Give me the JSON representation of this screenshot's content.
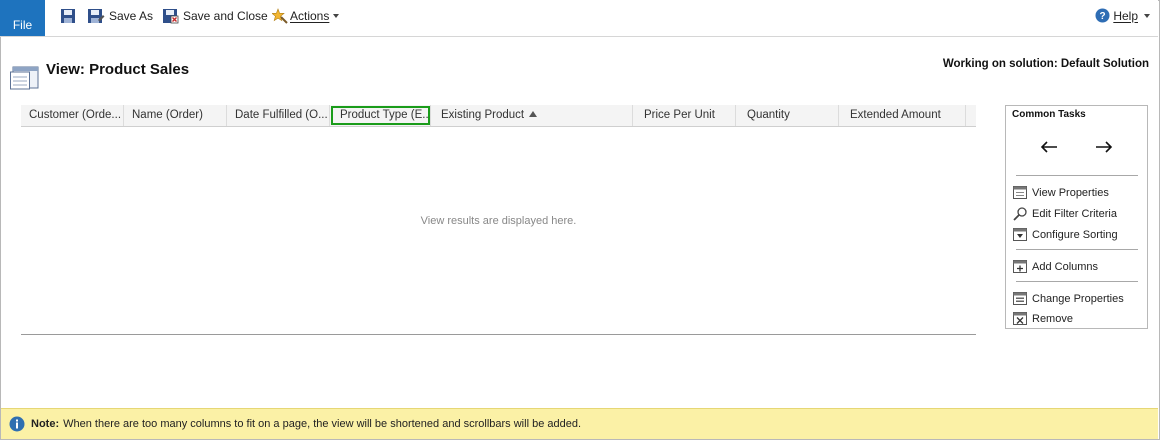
{
  "ribbon": {
    "file_label": "File",
    "save_label": "",
    "save_as_label": "Save As",
    "save_close_label": "Save and Close",
    "actions_label": "Actions",
    "help_label": "Help"
  },
  "header": {
    "title": "View: Product Sales",
    "solution": "Working on solution: Default Solution"
  },
  "grid": {
    "columns": [
      {
        "label": "Customer (Orde..."
      },
      {
        "label": "Name (Order)"
      },
      {
        "label": "Date Fulfilled (O..."
      },
      {
        "label": "Product Type (E..."
      },
      {
        "label": "Existing Product"
      },
      {
        "label": "Price Per Unit"
      },
      {
        "label": "Quantity"
      },
      {
        "label": "Extended Amount"
      }
    ],
    "selected_column": "Product Type (E...",
    "sorted_column": "Existing Product",
    "sort_direction": "ascending",
    "empty_message": "View results are displayed here."
  },
  "tasks": {
    "title": "Common Tasks",
    "items": [
      {
        "label": "View Properties",
        "icon": "view-properties-icon"
      },
      {
        "label": "Edit Filter Criteria",
        "icon": "filter-icon"
      },
      {
        "label": "Configure Sorting",
        "icon": "sort-icon"
      },
      {
        "label": "Add Columns",
        "icon": "add-columns-icon"
      },
      {
        "label": "Change Properties",
        "icon": "change-properties-icon"
      },
      {
        "label": "Remove",
        "icon": "remove-icon"
      }
    ]
  },
  "note": {
    "label": "Note:",
    "text": "When there are too many columns to fit on a page, the view will be shortened and scrollbars will be added."
  },
  "colors": {
    "file_tab": "#1e73be",
    "selected_outline": "#1a9c1a",
    "note_bar": "#fbf1a6"
  }
}
